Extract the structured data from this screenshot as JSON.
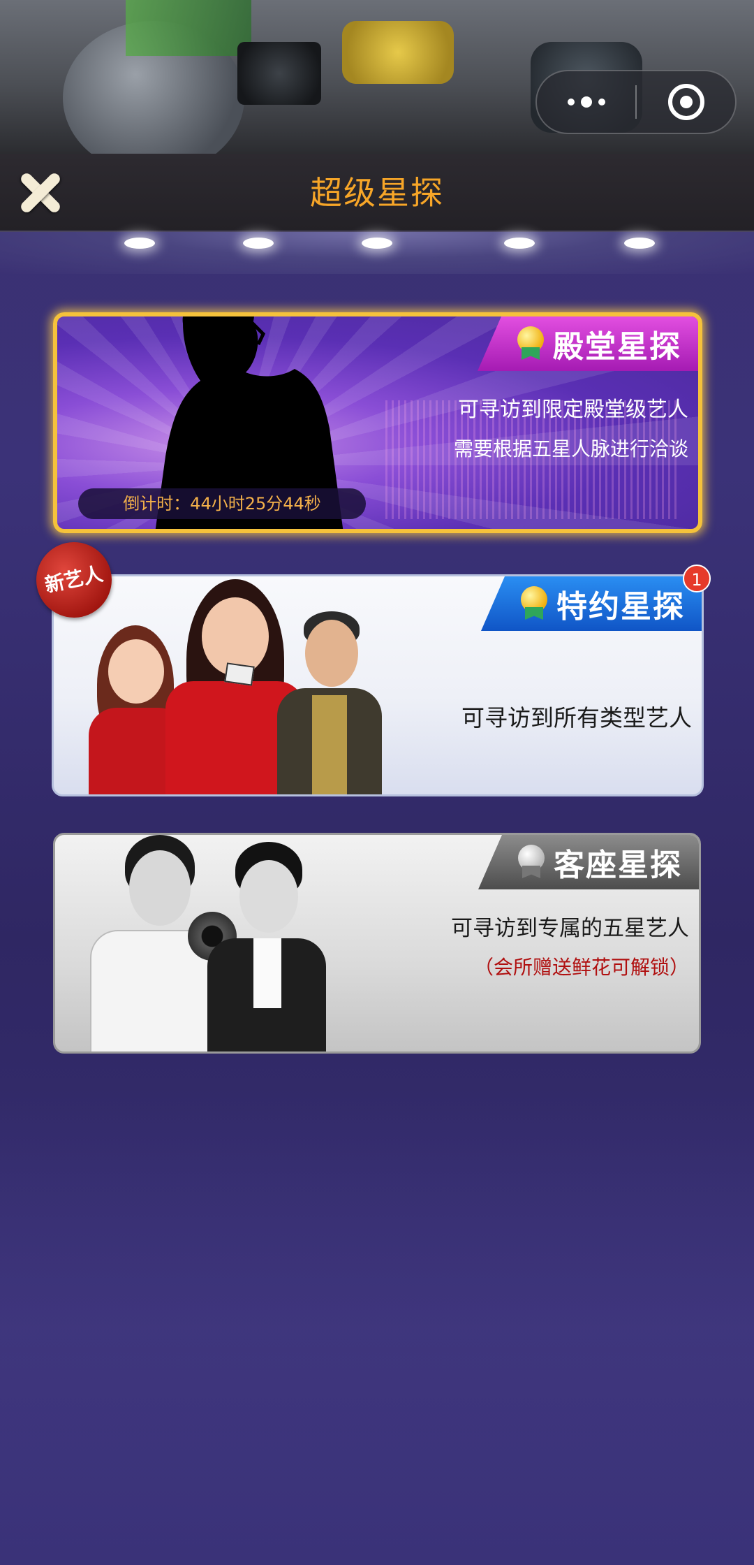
{
  "header": {
    "title": "超级星探",
    "close_icon": "close-icon",
    "menu_icon": "more-dots-icon",
    "exit_icon": "target-circle-icon"
  },
  "cards": {
    "hall": {
      "ribbon_label": "殿堂星探",
      "medal_icon": "gold-medal-icon",
      "desc_line1": "可寻访到限定殿堂级艺人",
      "desc_line2": "需要根据五星人脉进行洽谈",
      "countdown": "倒计时：44小时25分44秒",
      "accent": "#f5c23b"
    },
    "special": {
      "ribbon_label": "特约星探",
      "medal_icon": "gold-medal-icon",
      "desc_line1": "可寻访到所有类型艺人",
      "badge_count": "1",
      "new_seal": "新艺人",
      "accent": "#1f6fe0"
    },
    "guest": {
      "ribbon_label": "客座星探",
      "medal_icon": "silver-medal-icon",
      "desc_line1": "可寻访到专属的五星艺人",
      "desc_line2": "（会所赠送鲜花可解锁）",
      "accent": "#b01010"
    }
  }
}
